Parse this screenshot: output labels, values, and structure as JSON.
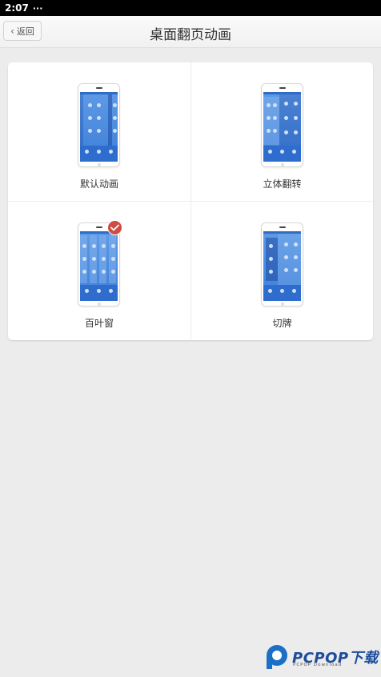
{
  "status_bar": {
    "time": "2:07",
    "more": "···"
  },
  "header": {
    "back_label": "返回",
    "title": "桌面翻页动画"
  },
  "options": [
    {
      "label": "默认动画",
      "selected": false
    },
    {
      "label": "立体翻转",
      "selected": false
    },
    {
      "label": "百叶窗",
      "selected": true
    },
    {
      "label": "切牌",
      "selected": false
    }
  ],
  "watermark": {
    "brand": "PCPOP下载",
    "sub": "PCPOP Download"
  },
  "colors": {
    "accent_check": "#cf4c41",
    "screen_blue": "#3d7fd8",
    "brand_blue": "#1b4d9a"
  }
}
